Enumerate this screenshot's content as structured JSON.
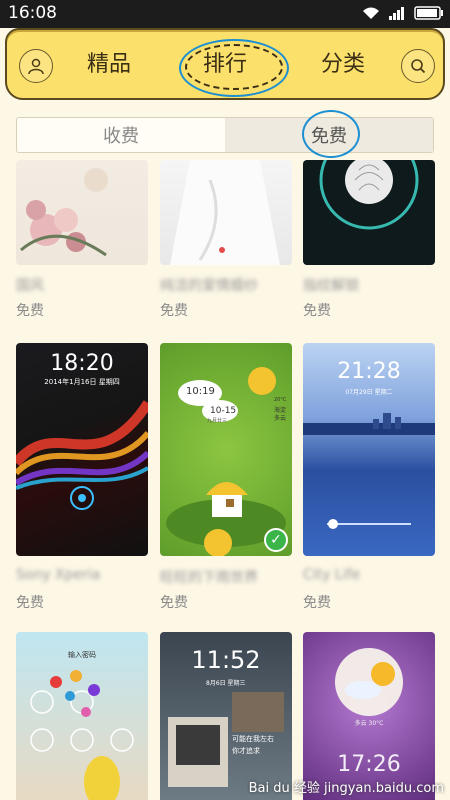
{
  "status_bar": {
    "time": "16:08"
  },
  "header": {
    "tabs": [
      {
        "label": "精品"
      },
      {
        "label": "排行"
      },
      {
        "label": "分类"
      }
    ]
  },
  "segment": {
    "paid": "收费",
    "free": "免费"
  },
  "cards": [
    {
      "price": "免费",
      "name": "国风"
    },
    {
      "price": "免费",
      "name": "纯洁的爱情婚纱"
    },
    {
      "price": "免费",
      "name": "指纹解锁"
    },
    {
      "price": "免费",
      "name": "Sony Xperia",
      "clock": "18:20",
      "date": "2014年1月16日 星期四"
    },
    {
      "price": "免费",
      "name": "旺旺的下雨世界",
      "c1": "10:19",
      "c2": "10-15",
      "c2sub": "九月廿三",
      "weather1": "20°C",
      "weather2": "海淀",
      "weather3": "多云"
    },
    {
      "price": "免费",
      "name": "City Life",
      "clock": "21:28",
      "date": "07月29日 星期二"
    },
    {
      "price": "",
      "name": "",
      "text": "输入密码"
    },
    {
      "price": "",
      "name": "",
      "clock": "11:52",
      "date": "8月6日 星期三",
      "note1": "可能在我左右",
      "note2": "你才追求"
    },
    {
      "price": "",
      "name": "",
      "weather": "多云 30°C",
      "clock": "17:26"
    }
  ],
  "watermark": "Bai du 经验 jingyan.baidu.com",
  "colors": {
    "header": "#fbe06b",
    "accent_circle": "#1b8fd1",
    "background": "#fdf7e6"
  }
}
